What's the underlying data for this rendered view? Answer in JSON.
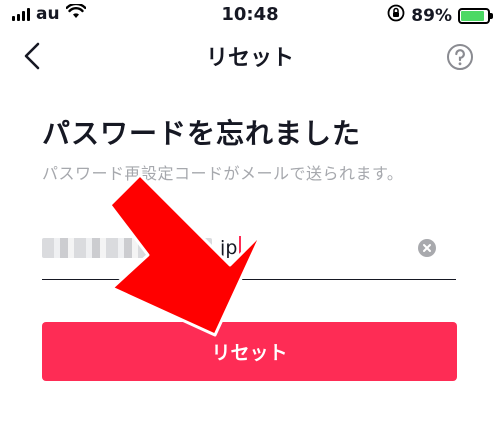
{
  "status_bar": {
    "carrier": "au",
    "time": "10:48",
    "battery_percent": "89%",
    "battery_level": 0.89,
    "icons": [
      "signal-icon",
      "wifi-icon",
      "orientation-lock-icon",
      "battery-icon"
    ]
  },
  "nav": {
    "title": "リセット",
    "back_icon": "chevron-left-icon",
    "help_icon": "help-circle-icon"
  },
  "main": {
    "heading": "パスワードを忘れました",
    "subtext": "パスワード再設定コードがメールで送られます。",
    "email": {
      "visible_value": ".jp",
      "clear_icon": "clear-icon"
    },
    "reset_button_label": "リセット"
  },
  "colors": {
    "accent": "#fe2c55",
    "annotation_arrow": "#ff0000",
    "subtext": "#a6a8ad"
  }
}
